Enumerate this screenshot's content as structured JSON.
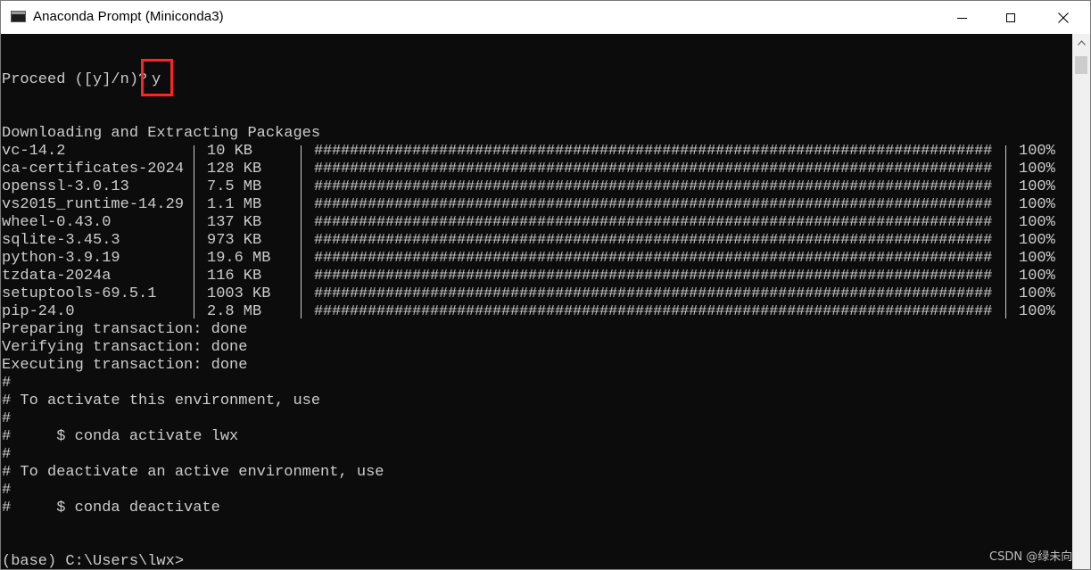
{
  "window": {
    "title": "Anaconda Prompt (Miniconda3)",
    "icon": "terminal-icon",
    "controls": {
      "minimize": "minimize-icon",
      "maximize": "maximize-icon",
      "close": "close-icon"
    }
  },
  "terminal": {
    "prompt_line": "Proceed ([y]/n)?",
    "user_input": "y",
    "downloading_header": "Downloading and Extracting Packages",
    "packages": [
      {
        "name": "vc-14.2",
        "size": "10 KB",
        "progress": 1.0,
        "percent": "100%"
      },
      {
        "name": "ca-certificates-2024",
        "size": "128 KB",
        "progress": 1.0,
        "percent": "100%"
      },
      {
        "name": "openssl-3.0.13",
        "size": "7.5 MB",
        "progress": 1.0,
        "percent": "100%"
      },
      {
        "name": "vs2015_runtime-14.29",
        "size": "1.1 MB",
        "progress": 1.0,
        "percent": "100%"
      },
      {
        "name": "wheel-0.43.0",
        "size": "137 KB",
        "progress": 1.0,
        "percent": "100%"
      },
      {
        "name": "sqlite-3.45.3",
        "size": "973 KB",
        "progress": 1.0,
        "percent": "100%"
      },
      {
        "name": "python-3.9.19",
        "size": "19.6 MB",
        "progress": 1.0,
        "percent": "100%"
      },
      {
        "name": "tzdata-2024a",
        "size": "116 KB",
        "progress": 1.0,
        "percent": "100%"
      },
      {
        "name": "setuptools-69.5.1",
        "size": "1003 KB",
        "progress": 1.0,
        "percent": "100%"
      },
      {
        "name": "pip-24.0",
        "size": "2.8 MB",
        "progress": 1.0,
        "percent": "100%"
      }
    ],
    "progress_bar": "############################################################################",
    "status_lines": [
      "Preparing transaction: done",
      "Verifying transaction: done",
      "Executing transaction: done"
    ],
    "info_lines": [
      "#",
      "# To activate this environment, use",
      "#",
      "#     $ conda activate lwx",
      "#",
      "# To deactivate an active environment, use",
      "#",
      "#     $ conda deactivate"
    ],
    "final_prompt": "(base) C:\\Users\\lwx>"
  },
  "watermark": "CSDN @绿未向",
  "colors": {
    "background": "#0c0c0c",
    "text": "#cccccc",
    "highlight": "#ff2424"
  }
}
